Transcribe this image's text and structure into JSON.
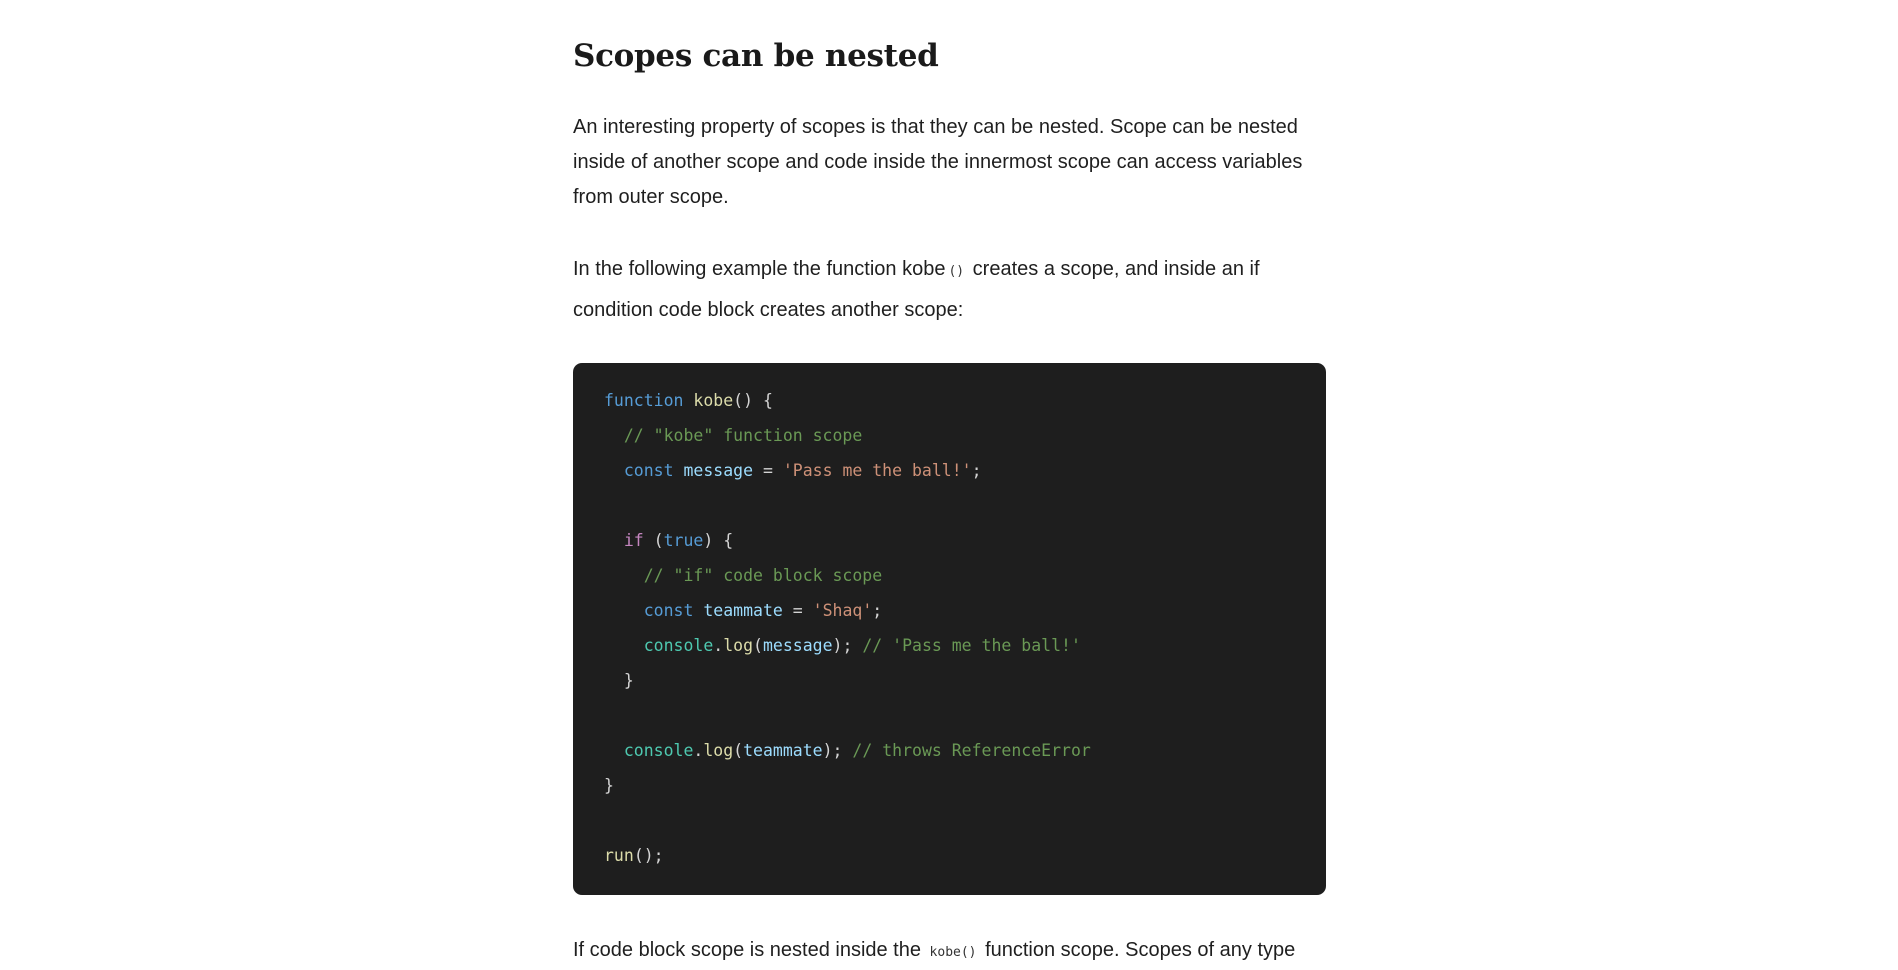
{
  "article": {
    "heading": "Scopes can be nested",
    "paragraph_1": "An interesting property of scopes is that they can be nested. Scope can be nested inside of another scope and code inside the innermost scope can access variables from outer scope.",
    "paragraph_2": {
      "before": "In the following example the function kobe",
      "code": "()",
      "after": " creates a scope, and inside an if condition code block creates another scope:"
    },
    "paragraph_3": {
      "before": "If code block scope is nested inside the ",
      "code": "kobe()",
      "after": " function scope. Scopes of any type"
    }
  },
  "code_block": {
    "language": "javascript",
    "lines": [
      [
        {
          "t": "function",
          "c": "keyword"
        },
        {
          "t": " ",
          "c": "punct"
        },
        {
          "t": "kobe",
          "c": "func"
        },
        {
          "t": "() {",
          "c": "punct"
        }
      ],
      [
        {
          "t": "  ",
          "c": "punct"
        },
        {
          "t": "// \"kobe\" function scope",
          "c": "comment"
        }
      ],
      [
        {
          "t": "  ",
          "c": "punct"
        },
        {
          "t": "const",
          "c": "keyword"
        },
        {
          "t": " ",
          "c": "punct"
        },
        {
          "t": "message",
          "c": "var"
        },
        {
          "t": " = ",
          "c": "punct"
        },
        {
          "t": "'Pass me the ball!'",
          "c": "string"
        },
        {
          "t": ";",
          "c": "punct"
        }
      ],
      [],
      [
        {
          "t": "  ",
          "c": "punct"
        },
        {
          "t": "if",
          "c": "control"
        },
        {
          "t": " (",
          "c": "punct"
        },
        {
          "t": "true",
          "c": "bool"
        },
        {
          "t": ") {",
          "c": "punct"
        }
      ],
      [
        {
          "t": "    ",
          "c": "punct"
        },
        {
          "t": "// \"if\" code block scope",
          "c": "comment"
        }
      ],
      [
        {
          "t": "    ",
          "c": "punct"
        },
        {
          "t": "const",
          "c": "keyword"
        },
        {
          "t": " ",
          "c": "punct"
        },
        {
          "t": "teammate",
          "c": "var"
        },
        {
          "t": " = ",
          "c": "punct"
        },
        {
          "t": "'Shaq'",
          "c": "string"
        },
        {
          "t": ";",
          "c": "punct"
        }
      ],
      [
        {
          "t": "    ",
          "c": "punct"
        },
        {
          "t": "console",
          "c": "object"
        },
        {
          "t": ".",
          "c": "punct"
        },
        {
          "t": "log",
          "c": "func"
        },
        {
          "t": "(",
          "c": "punct"
        },
        {
          "t": "message",
          "c": "var"
        },
        {
          "t": "); ",
          "c": "punct"
        },
        {
          "t": "// 'Pass me the ball!'",
          "c": "comment"
        }
      ],
      [
        {
          "t": "  }",
          "c": "punct"
        }
      ],
      [],
      [
        {
          "t": "  ",
          "c": "punct"
        },
        {
          "t": "console",
          "c": "object"
        },
        {
          "t": ".",
          "c": "punct"
        },
        {
          "t": "log",
          "c": "func"
        },
        {
          "t": "(",
          "c": "punct"
        },
        {
          "t": "teammate",
          "c": "var"
        },
        {
          "t": "); ",
          "c": "punct"
        },
        {
          "t": "// throws ReferenceError",
          "c": "comment"
        }
      ],
      [
        {
          "t": "}",
          "c": "punct"
        }
      ],
      [],
      [
        {
          "t": "run",
          "c": "func"
        },
        {
          "t": "();",
          "c": "punct"
        }
      ]
    ]
  },
  "colors": {
    "page_background": "#ffffff",
    "text": "#1f1f1f",
    "code_background": "#1e1e1e",
    "keyword": "#569cd6",
    "control": "#c586c0",
    "function": "#dcdcaa",
    "variable": "#9cdcfe",
    "string": "#ce9178",
    "comment": "#6a9955",
    "object": "#4ec9b0"
  }
}
